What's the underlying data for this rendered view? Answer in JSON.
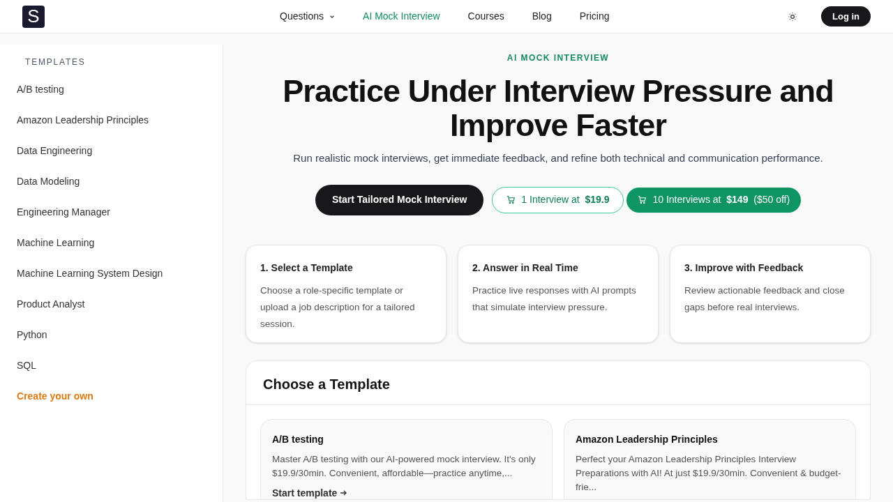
{
  "logo": {
    "letter": "S"
  },
  "nav": [
    {
      "label": "Questions",
      "dropdown": true,
      "selected": false
    },
    {
      "label": "AI Mock Interview",
      "dropdown": false,
      "selected": true
    },
    {
      "label": "Courses",
      "dropdown": false,
      "selected": false
    },
    {
      "label": "Blog",
      "dropdown": false,
      "selected": false
    },
    {
      "label": "Pricing",
      "dropdown": false,
      "selected": false
    }
  ],
  "login": "Log in",
  "sidebar": {
    "heading": "TEMPLATES",
    "items": [
      {
        "label": "A/B testing",
        "kind": "link"
      },
      {
        "label": "Amazon Leadership Principles",
        "kind": "link"
      },
      {
        "label": "Data Engineering",
        "kind": "link"
      },
      {
        "label": "Data Modeling",
        "kind": "link"
      },
      {
        "label": "Engineering Manager",
        "kind": "link"
      },
      {
        "label": "Machine Learning",
        "kind": "link"
      },
      {
        "label": "Machine Learning System Design",
        "kind": "link"
      },
      {
        "label": "Product Analyst",
        "kind": "link"
      },
      {
        "label": "Python",
        "kind": "link"
      },
      {
        "label": "SQL",
        "kind": "link"
      },
      {
        "label": "Create your own",
        "kind": "action"
      }
    ]
  },
  "hero": {
    "eyebrow": "AI MOCK INTERVIEW",
    "title": "Practice Under Interview Pressure and Improve Faster",
    "subtitle": "Run realistic mock interviews, get immediate feedback, and refine both technical and communication performance.",
    "buttons": [
      {
        "label": "Start Tailored Mock Interview",
        "kind": "primary"
      },
      {
        "label": "1 Interview at  **$19.9**",
        "kind": "outline"
      },
      {
        "label": "10 Interviews at  **$149**  ($50 off)",
        "kind": "solid"
      }
    ]
  },
  "steps": [
    {
      "title": "1. Select a Template",
      "text": "Choose a role-specific template or upload a job description for a tailored session."
    },
    {
      "title": "2. Answer in Real Time",
      "text": "Practice live responses with AI prompts that simulate interview pressure."
    },
    {
      "title": "3. Improve with Feedback",
      "text": "Review actionable feedback and close gaps before real interviews."
    }
  ],
  "templates": {
    "heading": "Choose a Template",
    "cards": [
      {
        "title": "A/B testing",
        "text": "Master A/B testing with our AI-powered mock interview. It's only $19.9/30min. Convenient, affordable—practice anytime,...",
        "link": "Start template"
      },
      {
        "title": "Amazon Leadership Principles",
        "text": "Perfect your Amazon Leadership Principles Interview Preparations with AI! At just $19.9/30min. Convenient & budget-frie..."
      }
    ]
  }
}
